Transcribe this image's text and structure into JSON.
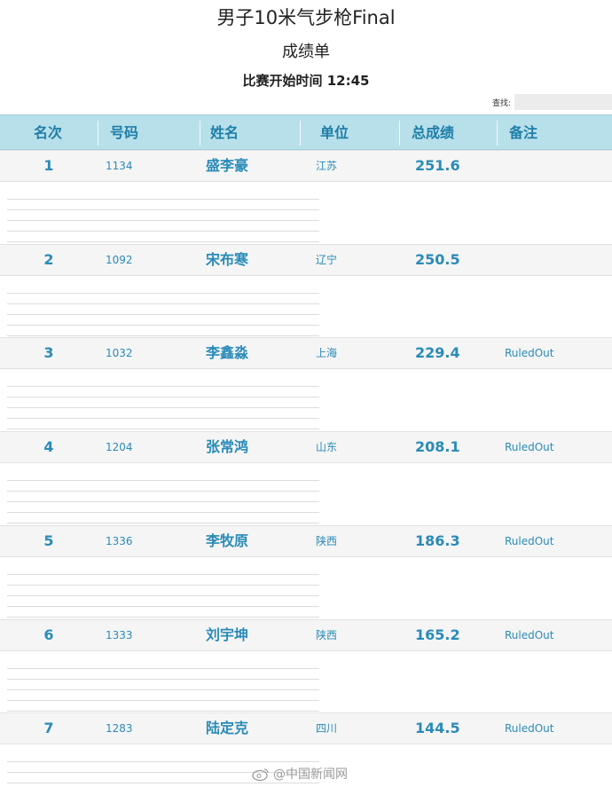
{
  "title": "男子10米气步枪Final",
  "subtitle": "成绩单",
  "start_time": "比赛开始时间 12:45",
  "search": {
    "label": "查找:",
    "value": ""
  },
  "columns": {
    "rank": "名次",
    "number": "号码",
    "name": "姓名",
    "unit": "单位",
    "score": "总成绩",
    "note": "备注"
  },
  "rows": [
    {
      "rank": "1",
      "number": "1134",
      "name": "盛李豪",
      "unit": "江苏",
      "score": "251.6",
      "note": ""
    },
    {
      "rank": "2",
      "number": "1092",
      "name": "宋布寒",
      "unit": "辽宁",
      "score": "250.5",
      "note": ""
    },
    {
      "rank": "3",
      "number": "1032",
      "name": "李鑫淼",
      "unit": "上海",
      "score": "229.4",
      "note": "RuledOut"
    },
    {
      "rank": "4",
      "number": "1204",
      "name": "张常鸿",
      "unit": "山东",
      "score": "208.1",
      "note": "RuledOut"
    },
    {
      "rank": "5",
      "number": "1336",
      "name": "李牧原",
      "unit": "陕西",
      "score": "186.3",
      "note": "RuledOut"
    },
    {
      "rank": "6",
      "number": "1333",
      "name": "刘宇坤",
      "unit": "陕西",
      "score": "165.2",
      "note": "RuledOut"
    },
    {
      "rank": "7",
      "number": "1283",
      "name": "陆定克",
      "unit": "四川",
      "score": "144.5",
      "note": "RuledOut"
    }
  ],
  "watermark": "@中国新闻网",
  "colors": {
    "header_bg": "#b8e0ea",
    "accent": "#2a8bb8",
    "header_text": "#1f7ea8"
  }
}
